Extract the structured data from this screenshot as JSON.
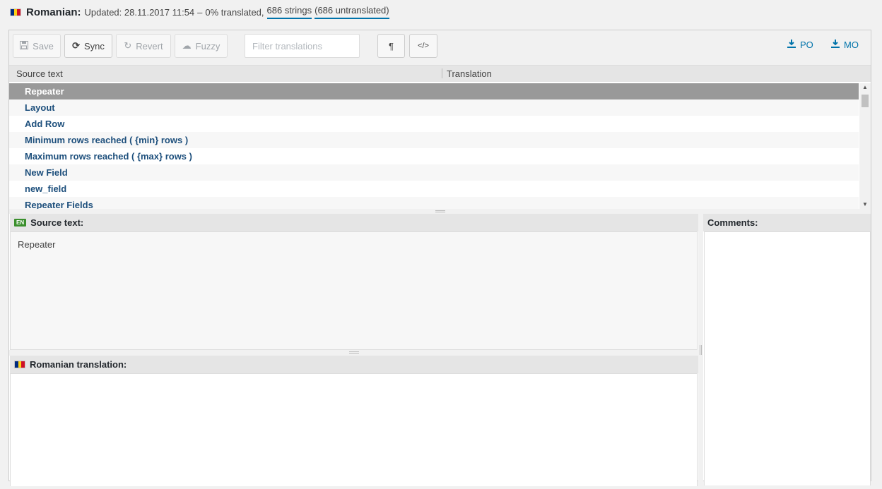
{
  "header": {
    "language": "Romanian:",
    "updated": "Updated: 28.11.2017 11:54",
    "dash": "–",
    "translated": "0% translated,",
    "strings": "686 strings",
    "untranslated": "(686 untranslated)",
    "flag_colors": [
      "#002b7f",
      "#fcd116",
      "#ce1126"
    ]
  },
  "toolbar": {
    "save_label": "Save",
    "sync_label": "Sync",
    "revert_label": "Revert",
    "fuzzy_label": "Fuzzy",
    "filter_placeholder": "Filter translations",
    "pilcrow_label": "¶",
    "code_label": "</>",
    "po_label": "PO",
    "mo_label": "MO"
  },
  "grid": {
    "source_header": "Source text",
    "translation_header": "Translation",
    "rows": [
      "Repeater",
      "Layout",
      "Add Row",
      "Minimum rows reached ( {min} rows )",
      "Maximum rows reached ( {max} rows )",
      "New Field",
      "new_field",
      "Repeater Fields"
    ],
    "selected_index": 0
  },
  "source_panel": {
    "badge": "EN",
    "title": "Source text:",
    "text": "Repeater"
  },
  "translation_panel": {
    "title": "Romanian translation:"
  },
  "comments_panel": {
    "title": "Comments:"
  },
  "colors": {
    "link": "#0073aa",
    "row_text": "#1d4f7c",
    "selected_row": "#999999"
  }
}
